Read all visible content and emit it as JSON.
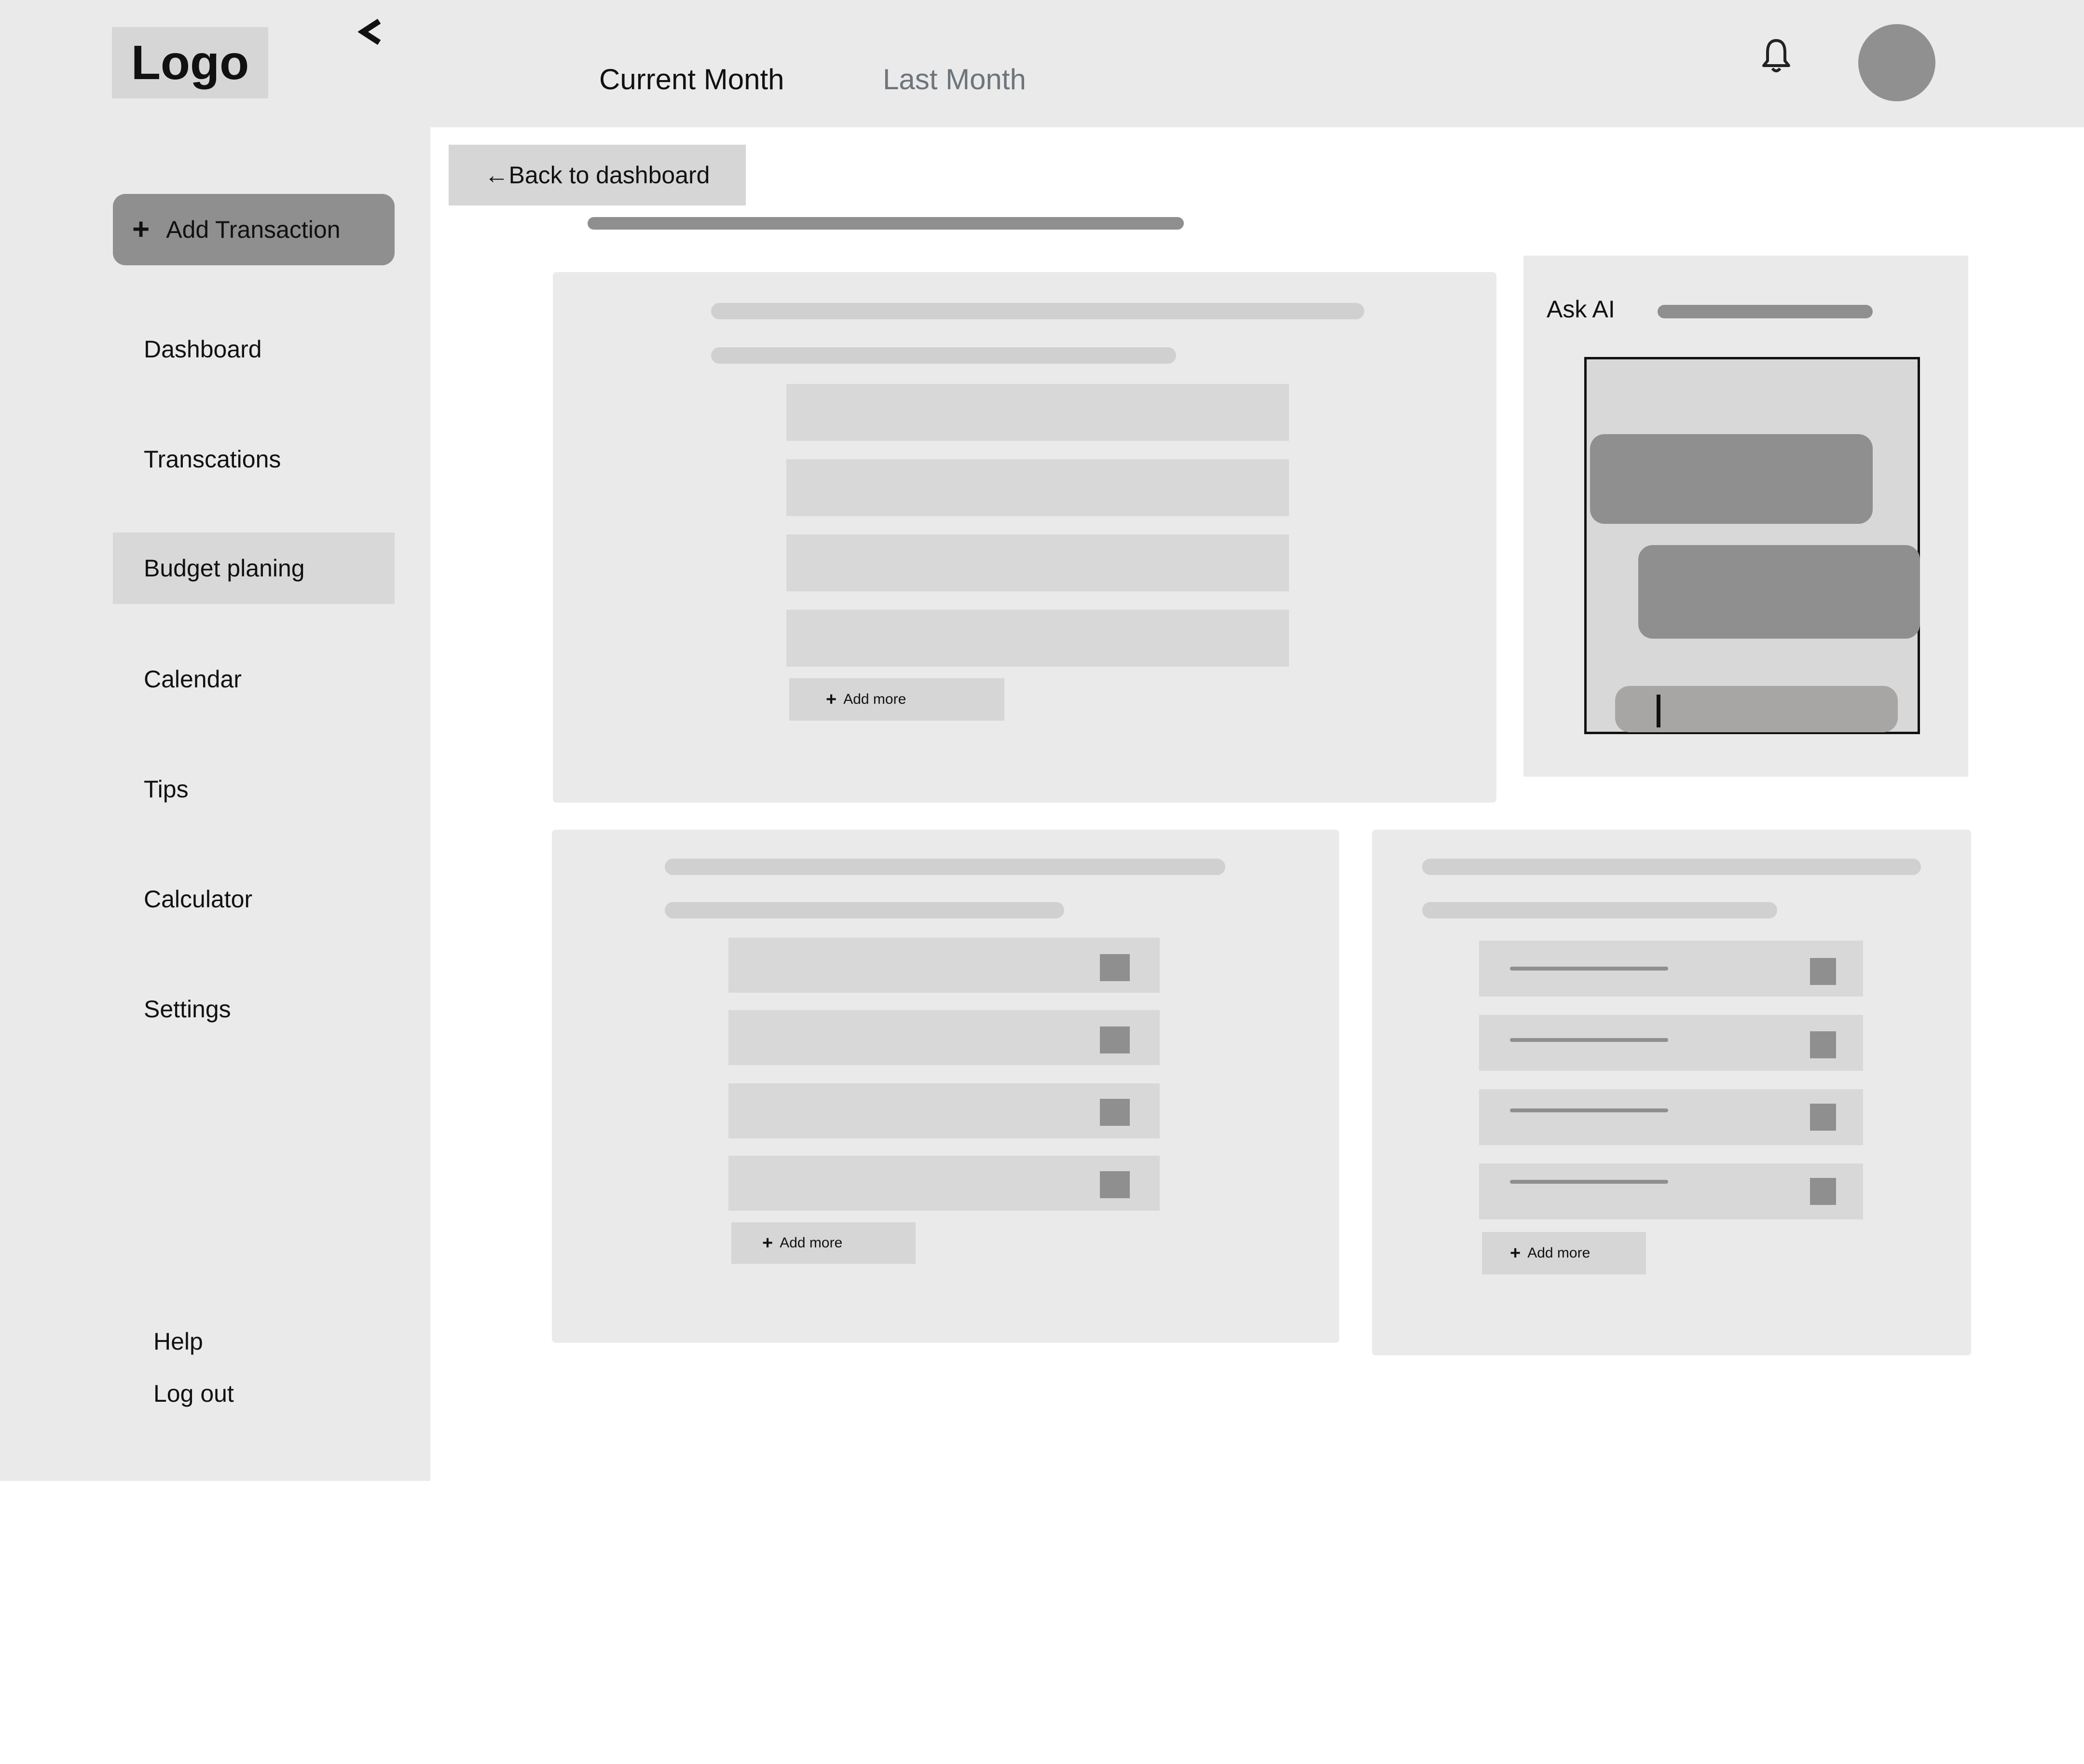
{
  "header": {
    "logo": "Logo",
    "collapse_glyph": "<",
    "tabs": [
      {
        "label": "Current Month",
        "active": true
      },
      {
        "label": "Last Month",
        "active": false
      }
    ],
    "notification_icon": "bell-icon",
    "avatar_icon": "avatar"
  },
  "sidebar": {
    "add_button": {
      "icon": "plus-icon",
      "glyph": "+",
      "label": "Add Transaction"
    },
    "items": [
      {
        "label": "Dashboard",
        "active": false
      },
      {
        "label": "Transcations",
        "active": false
      },
      {
        "label": "Budget planing",
        "active": true
      },
      {
        "label": "Calendar",
        "active": false
      },
      {
        "label": "Tips",
        "active": false
      },
      {
        "label": "Calculator",
        "active": false
      },
      {
        "label": "Settings",
        "active": false
      }
    ],
    "footer": {
      "help": "Help",
      "logout": "Log out"
    }
  },
  "main": {
    "back_button": {
      "arrow": "←",
      "label": "Back to dashboard"
    },
    "add_more_label": "Add more",
    "add_more_glyph": "+",
    "ask_ai": {
      "title": "Ask AI"
    }
  },
  "colors": {
    "background": "#eaeaea",
    "placeholder_dark": "#8f8f8f",
    "placeholder_light": "#d8d8d8",
    "tab_inactive": "#6e747c"
  }
}
